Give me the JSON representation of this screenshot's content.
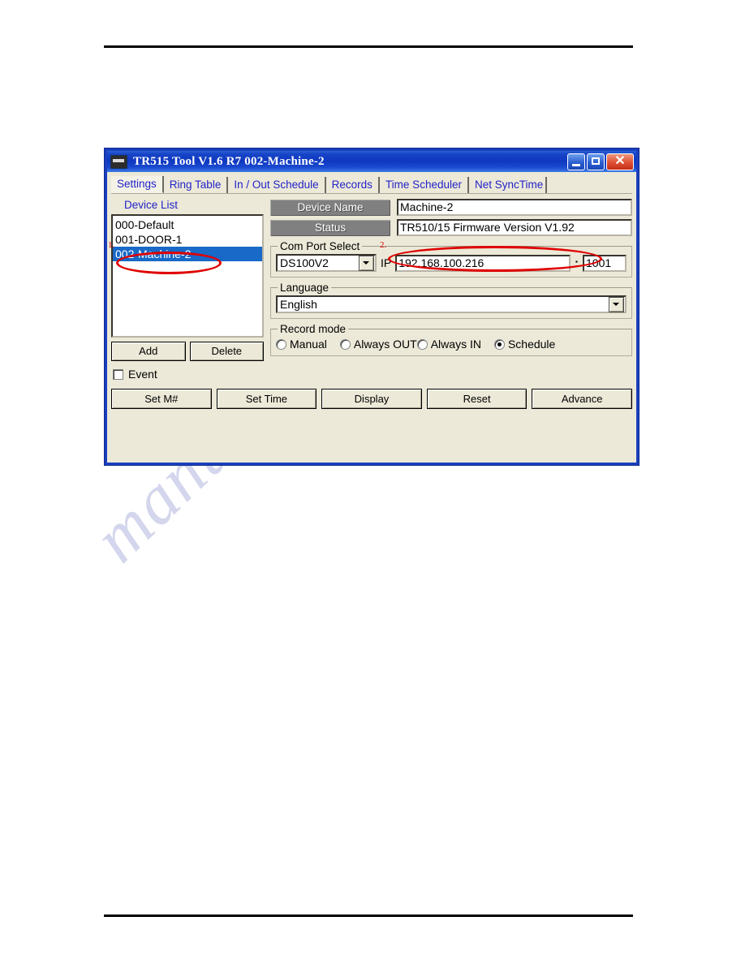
{
  "window": {
    "title": "TR515 Tool V1.6 R7   002-Machine-2",
    "icon": "device-icon",
    "controls": {
      "minimize": "minimize-icon",
      "maximize": "maximize-icon",
      "close": "close-icon"
    }
  },
  "tabs": [
    {
      "label": "Settings",
      "active": true
    },
    {
      "label": "Ring Table",
      "active": false
    },
    {
      "label": "In / Out Schedule",
      "active": false
    },
    {
      "label": "Records",
      "active": false
    },
    {
      "label": "Time Scheduler",
      "active": false
    },
    {
      "label": "Net SyncTime",
      "active": false
    }
  ],
  "device_list": {
    "label": "Device List",
    "items": [
      {
        "label": "000-Default",
        "selected": false
      },
      {
        "label": "001-DOOR-1",
        "selected": false
      },
      {
        "label": "002-Machine-2",
        "selected": true
      }
    ],
    "add_label": "Add",
    "delete_label": "Delete",
    "event_label": "Event",
    "event_checked": false
  },
  "fields": {
    "device_name_label": "Device Name",
    "device_name_value": "Machine-2",
    "status_label": "Status",
    "status_value": "TR510/15 Firmware Version V1.92"
  },
  "com_port": {
    "legend": "Com Port Select",
    "port_value": "DS100V2",
    "ip_label": "IP",
    "ip_value": "192.168.100.216",
    "separator": ":",
    "port_number": "1001"
  },
  "language": {
    "legend": "Language",
    "value": "English"
  },
  "record_mode": {
    "legend": "Record mode",
    "options": [
      {
        "label": "Manual",
        "checked": false
      },
      {
        "label": "Always OUT",
        "checked": false
      },
      {
        "label": "Always IN",
        "checked": false
      },
      {
        "label": "Schedule",
        "checked": true
      }
    ]
  },
  "action_buttons": [
    {
      "label": "Set M#"
    },
    {
      "label": "Set Time"
    },
    {
      "label": "Display"
    },
    {
      "label": "Reset"
    },
    {
      "label": "Advance"
    }
  ],
  "annotations": [
    {
      "number": "1."
    },
    {
      "number": "2."
    }
  ],
  "watermark": "manualshive.com",
  "colors": {
    "title_bar": "#0e38c0",
    "dialog_face": "#ece9d8",
    "selection": "#1869c8",
    "tab_text": "#2323c8",
    "grey_label": "#808080",
    "annotation": "#e00000"
  }
}
